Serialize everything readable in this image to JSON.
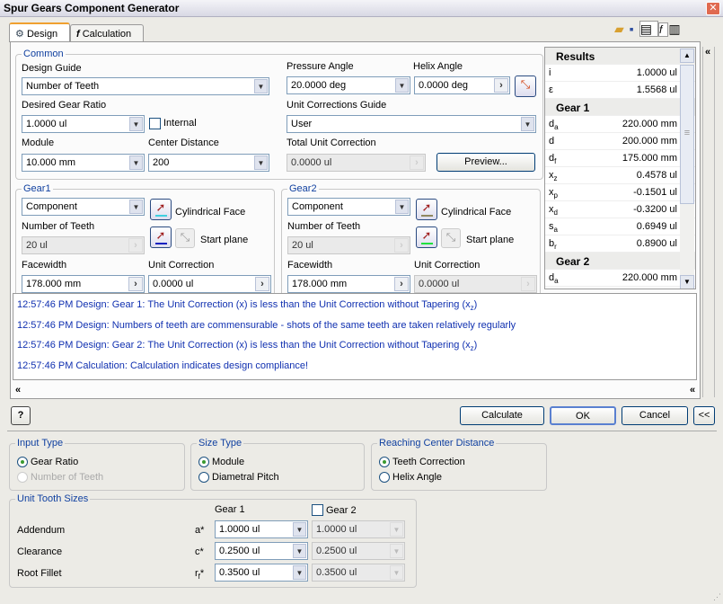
{
  "window": {
    "title": "Spur Gears Component Generator",
    "close": "✕"
  },
  "tabs": [
    {
      "label": "Design",
      "icon": "gear-icon"
    },
    {
      "label": "Calculation",
      "icon": "fx-icon"
    }
  ],
  "toolbar": {
    "icons": [
      "open-folder-icon",
      "save-icon",
      "properties-icon",
      "fx-icon",
      "notes-icon"
    ],
    "collapse": "«"
  },
  "common": {
    "title": "Common",
    "design_guide_label": "Design Guide",
    "design_guide": "Number of Teeth",
    "pressure_angle_label": "Pressure Angle",
    "pressure_angle": "20.0000 deg",
    "helix_angle_label": "Helix Angle",
    "helix_angle": "0.0000 deg",
    "gear_ratio_label": "Desired Gear Ratio",
    "gear_ratio": "1.0000 ul",
    "internal_label": "Internal",
    "unit_corr_guide_label": "Unit Corrections Guide",
    "unit_corr_guide": "User",
    "module_label": "Module",
    "module": "10.000 mm",
    "center_distance_label": "Center Distance",
    "center_distance": "200",
    "total_unit_corr_label": "Total Unit Correction",
    "total_unit_corr": "0.0000 ul",
    "preview": "Preview..."
  },
  "gear1": {
    "title": "Gear1",
    "type": "Component",
    "cyl_face": "Cylindrical Face",
    "teeth_label": "Number of Teeth",
    "teeth": "20 ul",
    "start_plane": "Start plane",
    "facewidth_label": "Facewidth",
    "facewidth": "178.000 mm",
    "unit_corr_label": "Unit Correction",
    "unit_corr": "0.0000 ul",
    "face_color": "#40d0e0",
    "plane_color": "#1020c0"
  },
  "gear2": {
    "title": "Gear2",
    "type": "Component",
    "cyl_face": "Cylindrical Face",
    "teeth_label": "Number of Teeth",
    "teeth": "20 ul",
    "start_plane": "Start plane",
    "facewidth_label": "Facewidth",
    "facewidth": "178.000 mm",
    "unit_corr_label": "Unit Correction",
    "unit_corr": "0.0000 ul",
    "face_color": "#908860",
    "plane_color": "#20e040"
  },
  "results": {
    "title": "Results",
    "rows": [
      {
        "k": "i",
        "v": "1.0000 ul"
      },
      {
        "k": "ε",
        "v": "1.5568 ul"
      }
    ],
    "gear1_title": "Gear 1",
    "gear1": [
      {
        "k": "d",
        "s": "a",
        "v": "220.000 mm"
      },
      {
        "k": "d",
        "s": "",
        "v": "200.000 mm"
      },
      {
        "k": "d",
        "s": "f",
        "v": "175.000 mm"
      },
      {
        "k": "x",
        "s": "z",
        "v": "0.4578 ul"
      },
      {
        "k": "x",
        "s": "p",
        "v": "-0.1501 ul"
      },
      {
        "k": "x",
        "s": "d",
        "v": "-0.3200 ul"
      },
      {
        "k": "s",
        "s": "a",
        "v": "0.6949 ul"
      },
      {
        "k": "b",
        "s": "r",
        "v": "0.8900 ul"
      }
    ],
    "gear2_title": "Gear 2",
    "gear2": [
      {
        "k": "d",
        "s": "a",
        "v": "220.000 mm"
      }
    ]
  },
  "messages": [
    {
      "pre": "12:57:46 PM Design: Gear 1: The Unit Correction (x) is less than the Unit Correction without Tapering (x",
      "sub": "z",
      "post": ")"
    },
    {
      "pre": "12:57:46 PM Design: Numbers of teeth are commensurable - shots of the same teeth are taken relatively regularly",
      "sub": "",
      "post": ""
    },
    {
      "pre": "12:57:46 PM Design: Gear 2: The Unit Correction (x) is less than the Unit Correction without Tapering (x",
      "sub": "z",
      "post": ")"
    },
    {
      "pre": "12:57:46 PM Calculation: Calculation indicates design compliance!",
      "sub": "",
      "post": ""
    }
  ],
  "buttons": {
    "help": "?",
    "calculate": "Calculate",
    "ok": "OK",
    "cancel": "Cancel",
    "collapse": "<<",
    "expand_down": "»",
    "expand_up": "«"
  },
  "input_type": {
    "title": "Input Type",
    "options": [
      "Gear Ratio",
      "Number of Teeth"
    ],
    "selected": 0
  },
  "size_type": {
    "title": "Size Type",
    "options": [
      "Module",
      "Diametral Pitch"
    ],
    "selected": 0
  },
  "reaching": {
    "title": "Reaching Center Distance",
    "options": [
      "Teeth Correction",
      "Helix Angle"
    ],
    "selected": 0
  },
  "unit_tooth": {
    "title": "Unit Tooth Sizes",
    "col1": "Gear 1",
    "col2": "Gear 2",
    "rows": [
      {
        "label": "Addendum",
        "sym": "a",
        "sub": "",
        "g1": "1.0000 ul",
        "g2": "1.0000 ul"
      },
      {
        "label": "Clearance",
        "sym": "c",
        "sub": "",
        "g1": "0.2500 ul",
        "g2": "0.2500 ul"
      },
      {
        "label": "Root Fillet",
        "sym": "r",
        "sub": "f",
        "g1": "0.3500 ul",
        "g2": "0.3500 ul"
      }
    ]
  }
}
